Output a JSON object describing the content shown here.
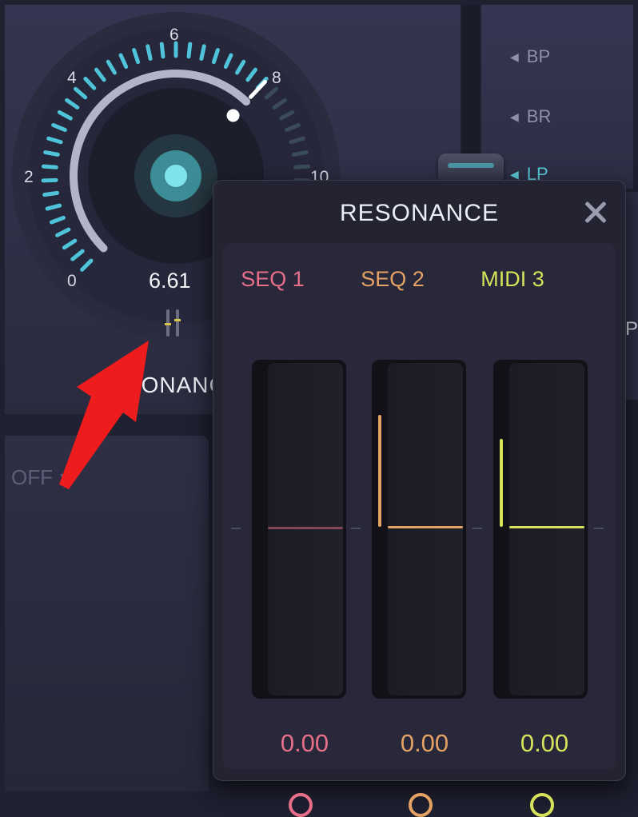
{
  "knob": {
    "tick_labels": [
      "0",
      "2",
      "4",
      "6",
      "8",
      "10"
    ],
    "value": "6.61",
    "level_fraction": 0.661,
    "label": "RESONANCE",
    "accent_color": "#4fc3d9",
    "mod_icon": "modulation-sliders-icon"
  },
  "filter_types": {
    "bp": "BP",
    "br": "BR",
    "lp": "LP",
    "arrow_icon": "triangle-left-icon"
  },
  "partial_letter": "P",
  "dropdown": {
    "value": "OFF",
    "caret_icon": "caret-down-icon"
  },
  "popup": {
    "title": "RESONANCE",
    "close_icon": "close-icon",
    "columns": [
      {
        "title": "SEQ 1",
        "value": "0.00",
        "color": "#e86f89",
        "mod_amount": 0.0
      },
      {
        "title": "SEQ 2",
        "value": "0.00",
        "color": "#e5a265",
        "mod_amount": 0.33
      },
      {
        "title": "MIDI 3",
        "value": "0.00",
        "color": "#d6e35a",
        "mod_amount": 0.26
      }
    ]
  },
  "annotation": {
    "arrow_color": "#ee1c1c",
    "icon": "pointer-arrow-icon"
  }
}
